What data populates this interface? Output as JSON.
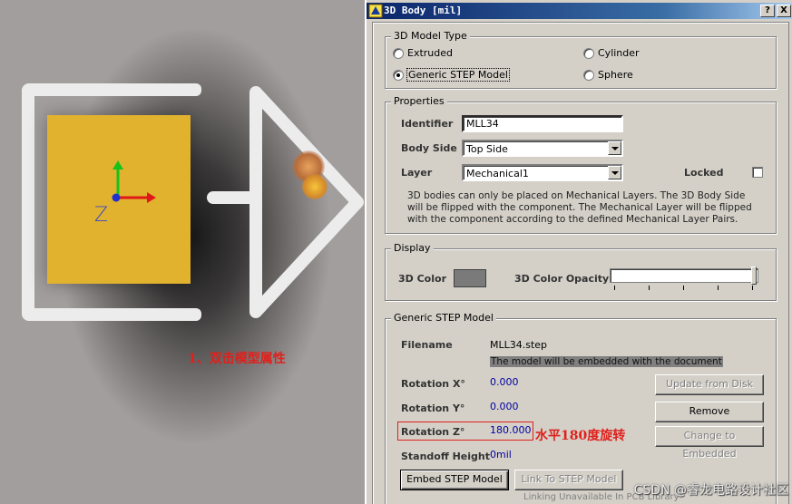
{
  "viewport": {
    "axis_label": "Z",
    "annotation": "1、双击模型属性"
  },
  "dialog": {
    "title": "3D Body [mil]",
    "help_label": "?",
    "close_label": "X",
    "model_type": {
      "legend": "3D Model Type",
      "options": [
        "Extruded",
        "Cylinder",
        "Generic STEP Model",
        "Sphere"
      ],
      "selected": "Generic STEP Model"
    },
    "properties": {
      "legend": "Properties",
      "identifier_label": "Identifier",
      "identifier_value": "MLL34",
      "body_side_label": "Body Side",
      "body_side_value": "Top Side",
      "layer_label": "Layer",
      "layer_value": "Mechanical1",
      "locked_label": "Locked",
      "locked": false,
      "info": "3D bodies can only be placed on Mechanical Layers. The 3D Body Side will be flipped with the component. The Mechanical Layer will be flipped with the component according to the defined Mechanical Layer Pairs."
    },
    "display": {
      "legend": "Display",
      "color_label": "3D Color",
      "color_value": "#7a7a7a",
      "opacity_label": "3D Color Opacity",
      "opacity_fraction": 1.0
    },
    "step": {
      "legend": "Generic STEP Model",
      "filename_label": "Filename",
      "filename_value": "MLL34.step",
      "embedded_note": "The model will be embedded with the document",
      "rot_x_label": "Rotation X°",
      "rot_x_value": "0.000",
      "rot_y_label": "Rotation Y°",
      "rot_y_value": "0.000",
      "rot_z_label": "Rotation Z°",
      "rot_z_value": "180.000",
      "standoff_label": "Standoff Height",
      "standoff_value": "0mil",
      "update_label": "Update from Disk",
      "remove_label": "Remove",
      "change_label": "Change to Embedded",
      "embed_label": "Embed STEP Model",
      "link_label": "Link To STEP Model",
      "link_note": "Linking Unavailable In PCB Library",
      "rotation_annotation": "水平180度旋转"
    },
    "watermark": "CSDN @睿龙电路设计社区"
  }
}
